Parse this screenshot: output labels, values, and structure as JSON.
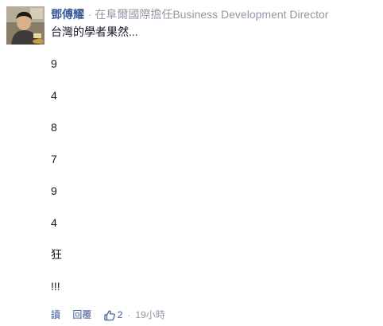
{
  "comment": {
    "author": "鄧傅耀",
    "separator": "·",
    "job": "在阜爾國際擔任Business Development Director",
    "lines": [
      "台灣的學者果然...",
      "9",
      "4",
      "8",
      "7",
      "9",
      "4",
      "狂",
      "!!!"
    ],
    "actions": {
      "translate_label": "讀",
      "reply_label": "回覆",
      "like_count": "2",
      "timestamp": "19小時",
      "separator": "·"
    },
    "icons": {
      "like": "thumbs-up-icon"
    },
    "colors": {
      "link": "#3b5998",
      "meta": "#9197a3",
      "text": "#141823"
    }
  }
}
